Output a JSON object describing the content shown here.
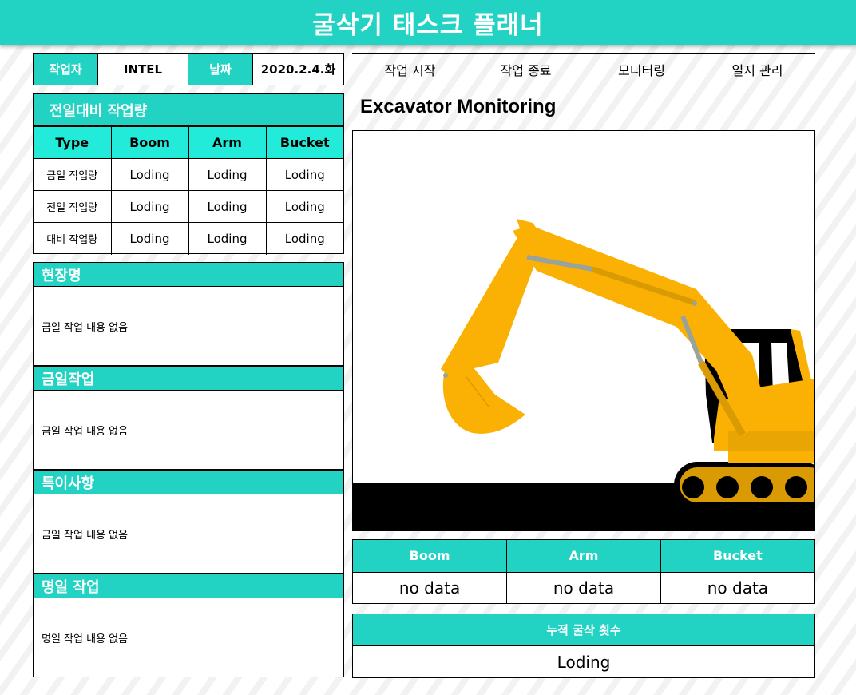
{
  "app": {
    "title": "굴삭기 태스크 플래너"
  },
  "info": {
    "worker_label": "작업자",
    "worker_value": "INTEL",
    "date_label": "날짜",
    "date_value": "2020.2.4.화"
  },
  "nav": {
    "items": [
      "작업 시작",
      "작업 종료",
      "모니터링",
      "일지 관리"
    ]
  },
  "comparison": {
    "title": "전일대비 작업량",
    "headers": [
      "Type",
      "Boom",
      "Arm",
      "Bucket"
    ],
    "rows": [
      [
        "금일 작업량",
        "Loding",
        "Loding",
        "Loding"
      ],
      [
        "전일 작업량",
        "Loding",
        "Loding",
        "Loding"
      ],
      [
        "대비 작업량",
        "Loding",
        "Loding",
        "Loding"
      ]
    ]
  },
  "sections": [
    {
      "title": "현장명",
      "body": "금일 작업 내용 없음"
    },
    {
      "title": "금일작업",
      "body": "금일 작업 내용 없음"
    },
    {
      "title": "특이사항",
      "body": "금일 작업 내용 없음"
    },
    {
      "title": "명일 작업",
      "body": "명일 작업 내용 없음"
    }
  ],
  "monitor": {
    "title": "Excavator Monitoring",
    "colors": {
      "body": "#fbb104",
      "shadow": "#d99a03",
      "ground": "#000000",
      "rod": "#9aa39a"
    }
  },
  "joints": {
    "headers": [
      "Boom",
      "Arm",
      "Bucket"
    ],
    "values": [
      "no data",
      "no data",
      "no data"
    ]
  },
  "accumulated": {
    "title": "누적 굴삭 횟수",
    "value": "Loding"
  },
  "colors": {
    "accent": "#22d3c3",
    "accent_light": "#22ecd9"
  }
}
